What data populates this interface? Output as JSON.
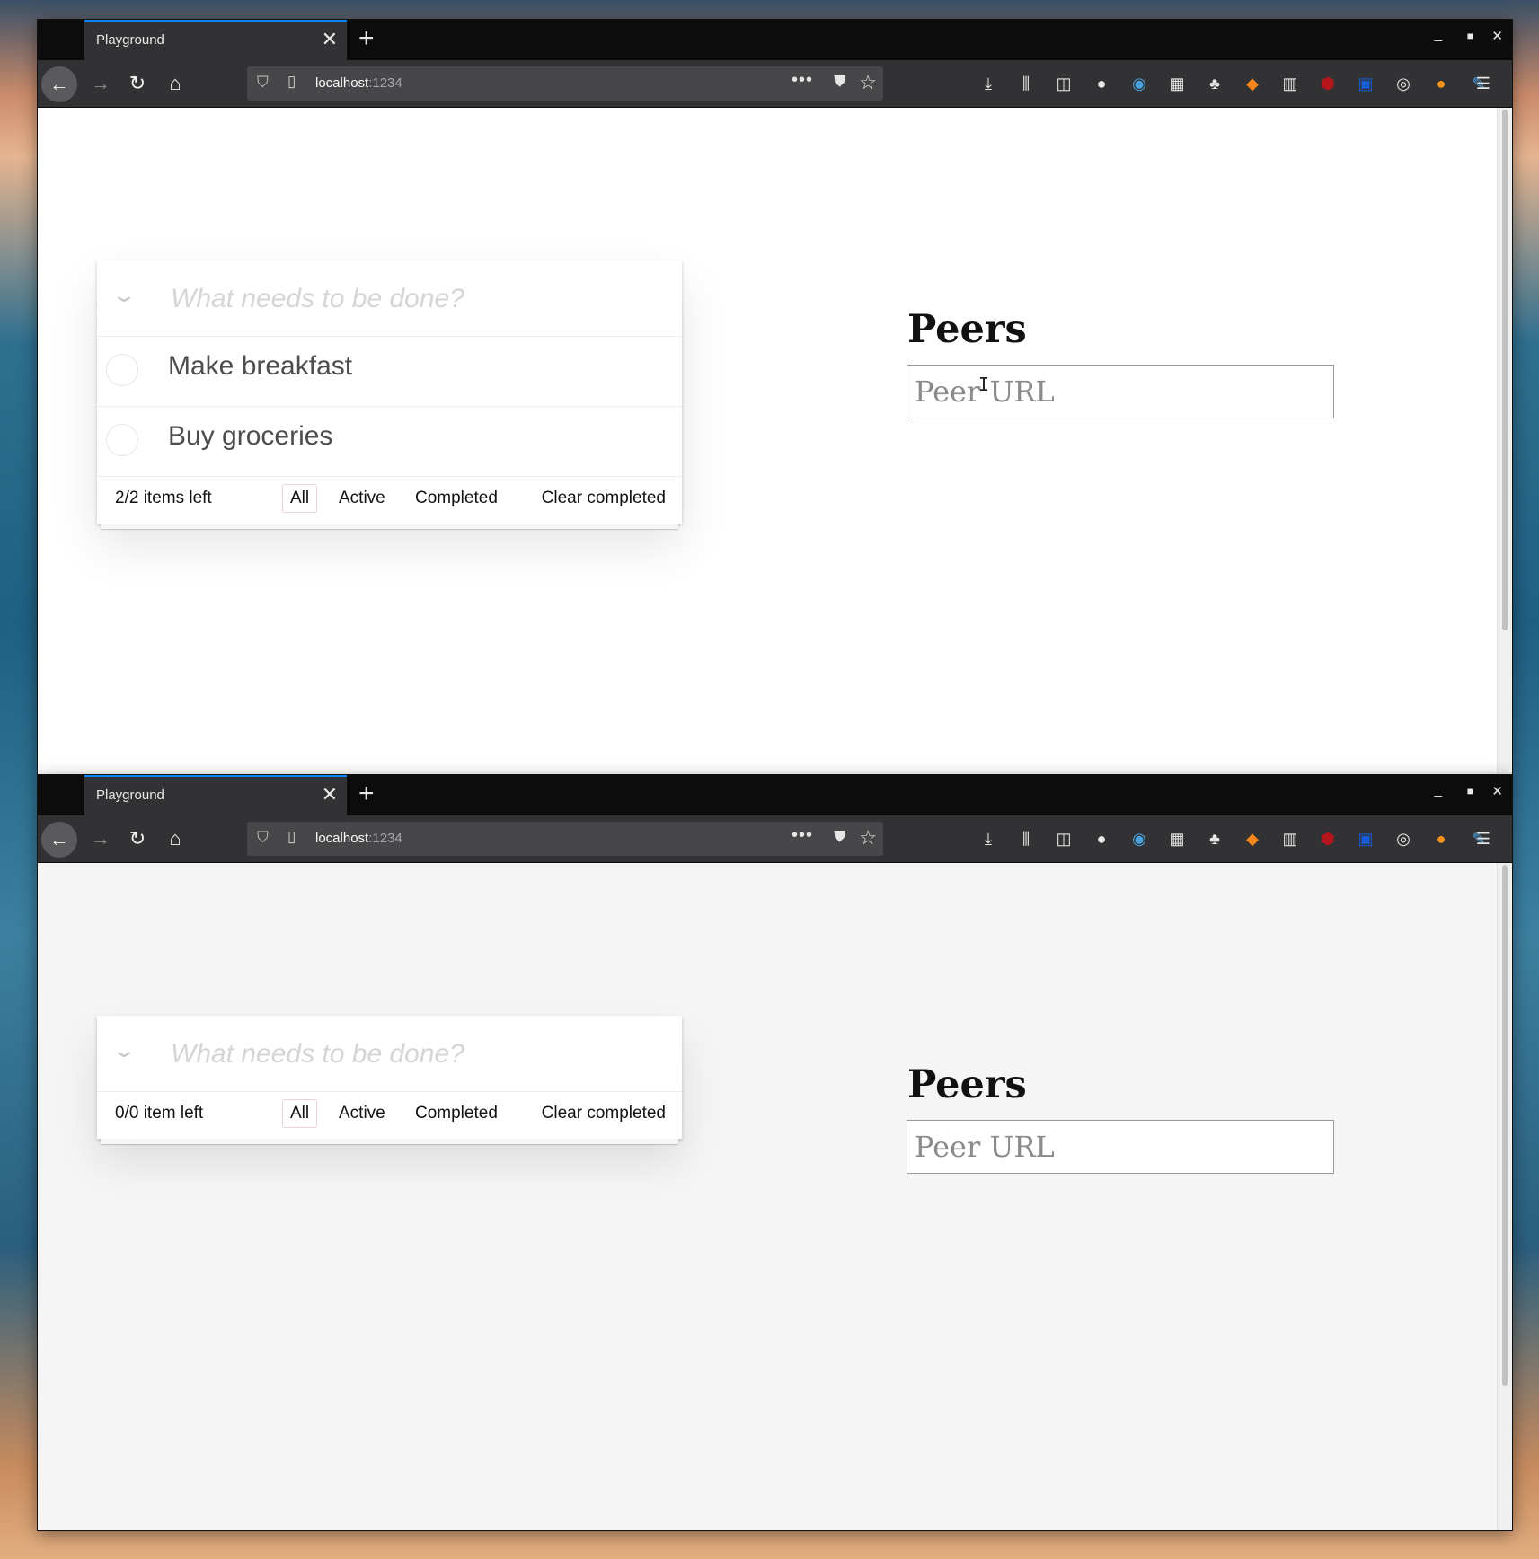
{
  "windows": [
    {
      "tab": {
        "title": "Playground"
      },
      "url": {
        "host": "localhost",
        "port": ":1234"
      },
      "todo": {
        "placeholder": "What needs to be done?",
        "items": [
          {
            "label": "Make breakfast",
            "completed": false
          },
          {
            "label": "Buy groceries",
            "completed": false
          }
        ],
        "footer": {
          "count": "2/2 items left",
          "filters": {
            "all": "All",
            "active": "Active",
            "completed": "Completed"
          },
          "selected_filter": "All",
          "clear": "Clear completed"
        }
      },
      "peers": {
        "title": "Peers",
        "placeholder": "Peer URL",
        "value": ""
      }
    },
    {
      "tab": {
        "title": "Playground"
      },
      "url": {
        "host": "localhost",
        "port": ":1234"
      },
      "todo": {
        "placeholder": "What needs to be done?",
        "items": [],
        "footer": {
          "count": "0/0 item left",
          "filters": {
            "all": "All",
            "active": "Active",
            "completed": "Completed"
          },
          "selected_filter": "All",
          "clear": "Clear completed"
        }
      },
      "peers": {
        "title": "Peers",
        "placeholder": "Peer URL",
        "value": ""
      }
    }
  ],
  "toolbar_icons": [
    {
      "name": "download-icon",
      "glyph": "⤓",
      "color": "#e6e6e6"
    },
    {
      "name": "library-icon",
      "glyph": "⫼",
      "color": "#e6e6e6"
    },
    {
      "name": "sidebar-icon",
      "glyph": "◫",
      "color": "#e6e6e6"
    },
    {
      "name": "account-icon",
      "glyph": "●",
      "color": "#e6e6e6"
    },
    {
      "name": "compass-extension-icon",
      "glyph": "◉",
      "color": "#4aa3df"
    },
    {
      "name": "apps-extension-icon",
      "glyph": "▦",
      "color": "#e6e6e6"
    },
    {
      "name": "gnome-extension-icon",
      "glyph": "♣",
      "color": "#e6e6e6"
    },
    {
      "name": "metamask-extension-icon",
      "glyph": "◆",
      "color": "#f6851b"
    },
    {
      "name": "grid-extension-icon",
      "glyph": "▥",
      "color": "#e6e6e6"
    },
    {
      "name": "ublock-extension-icon",
      "glyph": "⬢",
      "color": "#b5161b"
    },
    {
      "name": "bitwarden-extension-icon",
      "glyph": "▣",
      "color": "#175ddc"
    },
    {
      "name": "eye-extension-icon",
      "glyph": "◎",
      "color": "#e6e6e6"
    },
    {
      "name": "coin-extension-icon",
      "glyph": "●",
      "color": "#f7931a"
    },
    {
      "name": "devtools-extension-icon",
      "glyph": "✎",
      "color": "#4aa3df"
    }
  ],
  "menu": {
    "glyph": "☰"
  }
}
